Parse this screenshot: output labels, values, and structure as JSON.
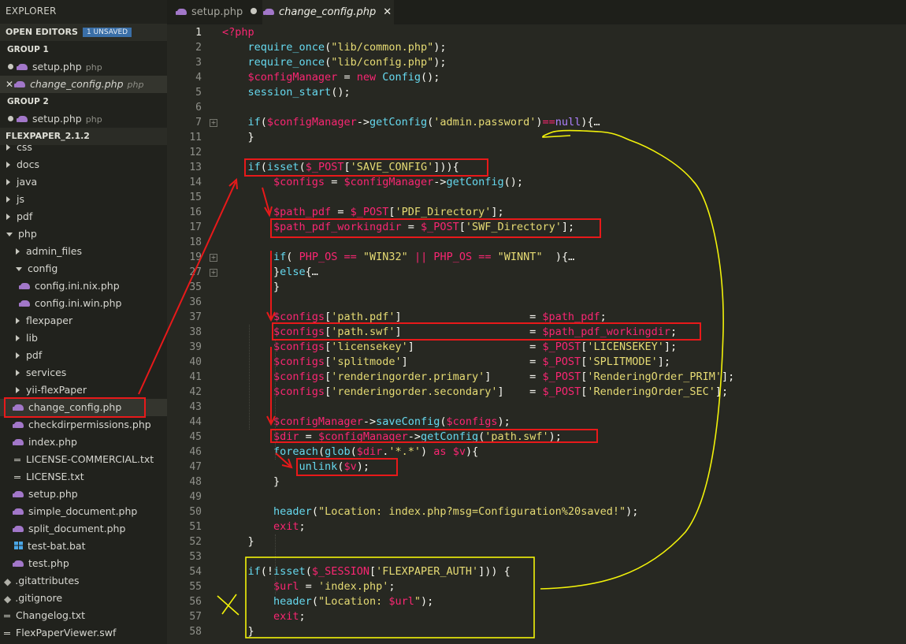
{
  "explorer": {
    "title": "EXPLORER",
    "open_editors_label": "OPEN EDITORS",
    "unsaved_badge": "1 UNSAVED",
    "groups": [
      {
        "label": "GROUP 1",
        "files": [
          {
            "name": "setup.php",
            "type": "php",
            "state": "modified"
          },
          {
            "name": "change_config.php",
            "type": "php",
            "state": "active"
          }
        ]
      },
      {
        "label": "GROUP 2",
        "files": [
          {
            "name": "setup.php",
            "type": "php",
            "state": "modified"
          }
        ]
      }
    ],
    "project_label": "FLEXPAPER_2.1.2",
    "tree": [
      {
        "name": "css",
        "kind": "folder",
        "depth": 0
      },
      {
        "name": "docs",
        "kind": "folder",
        "depth": 0
      },
      {
        "name": "java",
        "kind": "folder",
        "depth": 0
      },
      {
        "name": "js",
        "kind": "folder",
        "depth": 0
      },
      {
        "name": "pdf",
        "kind": "folder",
        "depth": 0
      },
      {
        "name": "php",
        "kind": "folder-open",
        "depth": 0
      },
      {
        "name": "admin_files",
        "kind": "folder",
        "depth": 1
      },
      {
        "name": "config",
        "kind": "folder-open",
        "depth": 1
      },
      {
        "name": "config.ini.nix.php",
        "kind": "php",
        "depth": 2
      },
      {
        "name": "config.ini.win.php",
        "kind": "php",
        "depth": 2
      },
      {
        "name": "flexpaper",
        "kind": "folder",
        "depth": 1
      },
      {
        "name": "lib",
        "kind": "folder",
        "depth": 1
      },
      {
        "name": "pdf",
        "kind": "folder",
        "depth": 1
      },
      {
        "name": "services",
        "kind": "folder",
        "depth": 1
      },
      {
        "name": "yii-flexPaper",
        "kind": "folder",
        "depth": 1
      },
      {
        "name": "change_config.php",
        "kind": "php",
        "depth": 1,
        "selected": true
      },
      {
        "name": "checkdirpermissions.php",
        "kind": "php",
        "depth": 1
      },
      {
        "name": "index.php",
        "kind": "php",
        "depth": 1
      },
      {
        "name": "LICENSE-COMMERCIAL.txt",
        "kind": "text",
        "depth": 1
      },
      {
        "name": "LICENSE.txt",
        "kind": "text",
        "depth": 1
      },
      {
        "name": "setup.php",
        "kind": "php",
        "depth": 1
      },
      {
        "name": "simple_document.php",
        "kind": "php",
        "depth": 1
      },
      {
        "name": "split_document.php",
        "kind": "php",
        "depth": 1
      },
      {
        "name": "test-bat.bat",
        "kind": "bat",
        "depth": 1
      },
      {
        "name": "test.php",
        "kind": "php",
        "depth": 1
      },
      {
        "name": ".gitattributes",
        "kind": "git",
        "depth": 0
      },
      {
        "name": ".gitignore",
        "kind": "git",
        "depth": 0
      },
      {
        "name": "Changelog.txt",
        "kind": "text",
        "depth": 0
      },
      {
        "name": "FlexPaperViewer.swf",
        "kind": "text",
        "depth": 0
      }
    ]
  },
  "tabs": [
    {
      "name": "setup.php",
      "active": false,
      "status": "modified"
    },
    {
      "name": "change_config.php",
      "active": true,
      "status": "close"
    }
  ],
  "editor": {
    "current_line": "1",
    "lines": [
      {
        "n": "1",
        "fold": false,
        "tokens": [
          {
            "t": "<?php",
            "c": "k"
          }
        ]
      },
      {
        "n": "2",
        "fold": false,
        "tokens": [
          {
            "t": "    "
          },
          {
            "t": "require_once",
            "c": "f"
          },
          {
            "t": "("
          },
          {
            "t": "\"lib/common.php\"",
            "c": "s"
          },
          {
            "t": ");"
          }
        ]
      },
      {
        "n": "3",
        "fold": false,
        "tokens": [
          {
            "t": "    "
          },
          {
            "t": "require_once",
            "c": "f"
          },
          {
            "t": "("
          },
          {
            "t": "\"lib/config.php\"",
            "c": "s"
          },
          {
            "t": ");"
          }
        ]
      },
      {
        "n": "4",
        "fold": false,
        "tokens": [
          {
            "t": "    "
          },
          {
            "t": "$configManager",
            "c": "v"
          },
          {
            "t": " = "
          },
          {
            "t": "new",
            "c": "k"
          },
          {
            "t": " "
          },
          {
            "t": "Config",
            "c": "f"
          },
          {
            "t": "();"
          }
        ]
      },
      {
        "n": "5",
        "fold": false,
        "tokens": [
          {
            "t": "    "
          },
          {
            "t": "session_start",
            "c": "f"
          },
          {
            "t": "();"
          }
        ]
      },
      {
        "n": "6",
        "fold": false,
        "tokens": []
      },
      {
        "n": "7",
        "fold": true,
        "tokens": [
          {
            "t": "    "
          },
          {
            "t": "if",
            "c": "f"
          },
          {
            "t": "("
          },
          {
            "t": "$configManager",
            "c": "v"
          },
          {
            "t": "->"
          },
          {
            "t": "getConfig",
            "c": "f"
          },
          {
            "t": "("
          },
          {
            "t": "'admin.password'",
            "c": "s"
          },
          {
            "t": ")"
          },
          {
            "t": "==",
            "c": "k"
          },
          {
            "t": "null",
            "c": "c"
          },
          {
            "t": "){…"
          }
        ]
      },
      {
        "n": "11",
        "fold": false,
        "tokens": [
          {
            "t": "    }"
          }
        ]
      },
      {
        "n": "12",
        "fold": false,
        "tokens": []
      },
      {
        "n": "13",
        "fold": false,
        "tokens": [
          {
            "t": "    "
          },
          {
            "t": "if",
            "c": "f"
          },
          {
            "t": "("
          },
          {
            "t": "isset",
            "c": "f"
          },
          {
            "t": "("
          },
          {
            "t": "$_POST",
            "c": "v"
          },
          {
            "t": "["
          },
          {
            "t": "'SAVE_CONFIG'",
            "c": "s"
          },
          {
            "t": "])){"
          }
        ]
      },
      {
        "n": "14",
        "fold": false,
        "tokens": [
          {
            "t": "        "
          },
          {
            "t": "$configs",
            "c": "v"
          },
          {
            "t": " = "
          },
          {
            "t": "$configManager",
            "c": "v"
          },
          {
            "t": "->"
          },
          {
            "t": "getConfig",
            "c": "f"
          },
          {
            "t": "();"
          }
        ]
      },
      {
        "n": "15",
        "fold": false,
        "tokens": []
      },
      {
        "n": "16",
        "fold": false,
        "tokens": [
          {
            "t": "        "
          },
          {
            "t": "$path_pdf",
            "c": "v"
          },
          {
            "t": " = "
          },
          {
            "t": "$_POST",
            "c": "v"
          },
          {
            "t": "["
          },
          {
            "t": "'PDF_Directory'",
            "c": "s"
          },
          {
            "t": "];"
          }
        ]
      },
      {
        "n": "17",
        "fold": false,
        "tokens": [
          {
            "t": "        "
          },
          {
            "t": "$path_pdf_workingdir",
            "c": "v"
          },
          {
            "t": " = "
          },
          {
            "t": "$_POST",
            "c": "v"
          },
          {
            "t": "["
          },
          {
            "t": "'SWF_Directory'",
            "c": "s"
          },
          {
            "t": "];"
          }
        ]
      },
      {
        "n": "18",
        "fold": false,
        "tokens": []
      },
      {
        "n": "19",
        "fold": true,
        "tokens": [
          {
            "t": "        "
          },
          {
            "t": "if",
            "c": "f"
          },
          {
            "t": "( "
          },
          {
            "t": "PHP_OS",
            "c": "v"
          },
          {
            "t": " "
          },
          {
            "t": "==",
            "c": "k"
          },
          {
            "t": " "
          },
          {
            "t": "\"WIN32\"",
            "c": "s"
          },
          {
            "t": " "
          },
          {
            "t": "||",
            "c": "k"
          },
          {
            "t": " "
          },
          {
            "t": "PHP_OS",
            "c": "v"
          },
          {
            "t": " "
          },
          {
            "t": "==",
            "c": "k"
          },
          {
            "t": " "
          },
          {
            "t": "\"WINNT\"",
            "c": "s"
          },
          {
            "t": "  ){…"
          }
        ]
      },
      {
        "n": "27",
        "fold": true,
        "tokens": [
          {
            "t": "        }"
          },
          {
            "t": "else",
            "c": "f"
          },
          {
            "t": "{…"
          }
        ]
      },
      {
        "n": "35",
        "fold": false,
        "tokens": [
          {
            "t": "        }"
          }
        ]
      },
      {
        "n": "36",
        "fold": false,
        "tokens": []
      },
      {
        "n": "37",
        "fold": false,
        "tokens": [
          {
            "t": "        "
          },
          {
            "t": "$configs",
            "c": "v"
          },
          {
            "t": "["
          },
          {
            "t": "'path.pdf'",
            "c": "s"
          },
          {
            "t": "]                    = "
          },
          {
            "t": "$path_pdf",
            "c": "v"
          },
          {
            "t": ";"
          }
        ]
      },
      {
        "n": "38",
        "fold": false,
        "tokens": [
          {
            "t": "        "
          },
          {
            "t": "$configs",
            "c": "v"
          },
          {
            "t": "["
          },
          {
            "t": "'path.swf'",
            "c": "s"
          },
          {
            "t": "]                    = "
          },
          {
            "t": "$path_pdf_workingdir",
            "c": "v"
          },
          {
            "t": ";"
          }
        ]
      },
      {
        "n": "39",
        "fold": false,
        "tokens": [
          {
            "t": "        "
          },
          {
            "t": "$configs",
            "c": "v"
          },
          {
            "t": "["
          },
          {
            "t": "'licensekey'",
            "c": "s"
          },
          {
            "t": "]                  = "
          },
          {
            "t": "$_POST",
            "c": "v"
          },
          {
            "t": "["
          },
          {
            "t": "'LICENSEKEY'",
            "c": "s"
          },
          {
            "t": "];"
          }
        ]
      },
      {
        "n": "40",
        "fold": false,
        "tokens": [
          {
            "t": "        "
          },
          {
            "t": "$configs",
            "c": "v"
          },
          {
            "t": "["
          },
          {
            "t": "'splitmode'",
            "c": "s"
          },
          {
            "t": "]                   = "
          },
          {
            "t": "$_POST",
            "c": "v"
          },
          {
            "t": "["
          },
          {
            "t": "'SPLITMODE'",
            "c": "s"
          },
          {
            "t": "];"
          }
        ]
      },
      {
        "n": "41",
        "fold": false,
        "tokens": [
          {
            "t": "        "
          },
          {
            "t": "$configs",
            "c": "v"
          },
          {
            "t": "["
          },
          {
            "t": "'renderingorder.primary'",
            "c": "s"
          },
          {
            "t": "]      = "
          },
          {
            "t": "$_POST",
            "c": "v"
          },
          {
            "t": "["
          },
          {
            "t": "'RenderingOrder_PRIM'",
            "c": "s"
          },
          {
            "t": "];"
          }
        ]
      },
      {
        "n": "42",
        "fold": false,
        "tokens": [
          {
            "t": "        "
          },
          {
            "t": "$configs",
            "c": "v"
          },
          {
            "t": "["
          },
          {
            "t": "'renderingorder.secondary'",
            "c": "s"
          },
          {
            "t": "]    = "
          },
          {
            "t": "$_POST",
            "c": "v"
          },
          {
            "t": "["
          },
          {
            "t": "'RenderingOrder_SEC'",
            "c": "s"
          },
          {
            "t": "];"
          }
        ]
      },
      {
        "n": "43",
        "fold": false,
        "tokens": []
      },
      {
        "n": "44",
        "fold": false,
        "tokens": [
          {
            "t": "        "
          },
          {
            "t": "$configManager",
            "c": "v"
          },
          {
            "t": "->"
          },
          {
            "t": "saveConfig",
            "c": "f"
          },
          {
            "t": "("
          },
          {
            "t": "$configs",
            "c": "v"
          },
          {
            "t": ");"
          }
        ]
      },
      {
        "n": "45",
        "fold": false,
        "tokens": [
          {
            "t": "        "
          },
          {
            "t": "$dir",
            "c": "v"
          },
          {
            "t": " = "
          },
          {
            "t": "$configManager",
            "c": "v"
          },
          {
            "t": "->"
          },
          {
            "t": "getConfig",
            "c": "f"
          },
          {
            "t": "("
          },
          {
            "t": "'path.swf'",
            "c": "s"
          },
          {
            "t": ");"
          }
        ]
      },
      {
        "n": "46",
        "fold": false,
        "tokens": [
          {
            "t": "        "
          },
          {
            "t": "foreach",
            "c": "f"
          },
          {
            "t": "("
          },
          {
            "t": "glob",
            "c": "f"
          },
          {
            "t": "("
          },
          {
            "t": "$dir",
            "c": "v"
          },
          {
            "t": "."
          },
          {
            "t": "'*.*'",
            "c": "s"
          },
          {
            "t": ") "
          },
          {
            "t": "as",
            "c": "k"
          },
          {
            "t": " "
          },
          {
            "t": "$v",
            "c": "v"
          },
          {
            "t": "){"
          }
        ]
      },
      {
        "n": "47",
        "fold": false,
        "tokens": [
          {
            "t": "            "
          },
          {
            "t": "unlink",
            "c": "f"
          },
          {
            "t": "("
          },
          {
            "t": "$v",
            "c": "v"
          },
          {
            "t": ");"
          }
        ]
      },
      {
        "n": "48",
        "fold": false,
        "tokens": [
          {
            "t": "        }"
          }
        ]
      },
      {
        "n": "49",
        "fold": false,
        "tokens": []
      },
      {
        "n": "50",
        "fold": false,
        "tokens": [
          {
            "t": "        "
          },
          {
            "t": "header",
            "c": "f"
          },
          {
            "t": "("
          },
          {
            "t": "\"Location: index.php?msg=Configuration%20saved!\"",
            "c": "s"
          },
          {
            "t": ");"
          }
        ]
      },
      {
        "n": "51",
        "fold": false,
        "tokens": [
          {
            "t": "        "
          },
          {
            "t": "exit",
            "c": "k"
          },
          {
            "t": ";"
          }
        ]
      },
      {
        "n": "52",
        "fold": false,
        "tokens": [
          {
            "t": "    }"
          }
        ]
      },
      {
        "n": "53",
        "fold": false,
        "tokens": []
      },
      {
        "n": "54",
        "fold": false,
        "tokens": [
          {
            "t": "    "
          },
          {
            "t": "if",
            "c": "f"
          },
          {
            "t": "(!"
          },
          {
            "t": "isset",
            "c": "f"
          },
          {
            "t": "("
          },
          {
            "t": "$_SESSION",
            "c": "v"
          },
          {
            "t": "["
          },
          {
            "t": "'FLEXPAPER_AUTH'",
            "c": "s"
          },
          {
            "t": "])) {"
          }
        ]
      },
      {
        "n": "55",
        "fold": false,
        "tokens": [
          {
            "t": "        "
          },
          {
            "t": "$url",
            "c": "v"
          },
          {
            "t": " = "
          },
          {
            "t": "'index.php'",
            "c": "s"
          },
          {
            "t": ";"
          }
        ]
      },
      {
        "n": "56",
        "fold": false,
        "tokens": [
          {
            "t": "        "
          },
          {
            "t": "header",
            "c": "f"
          },
          {
            "t": "("
          },
          {
            "t": "\"Location: ",
            "c": "s"
          },
          {
            "t": "$url",
            "c": "v"
          },
          {
            "t": "\"",
            "c": "s"
          },
          {
            "t": ");"
          }
        ]
      },
      {
        "n": "57",
        "fold": false,
        "tokens": [
          {
            "t": "        "
          },
          {
            "t": "exit",
            "c": "k"
          },
          {
            "t": ";"
          }
        ]
      },
      {
        "n": "58",
        "fold": false,
        "tokens": [
          {
            "t": "    }"
          }
        ]
      }
    ]
  },
  "colors": {
    "annotation_red": "#e8191a",
    "annotation_yellow": "#f2f20a"
  }
}
